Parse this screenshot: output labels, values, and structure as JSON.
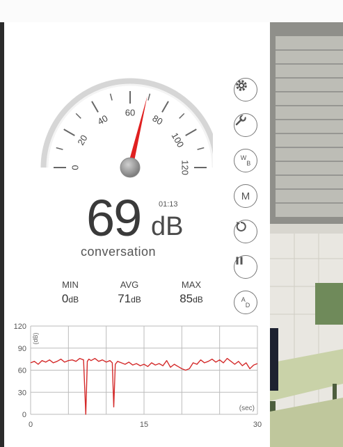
{
  "meter": {
    "value": "69",
    "unit": "dB",
    "timer": "01:13",
    "category": "conversation",
    "needle_value": 69,
    "scale_max": 120
  },
  "gauge": {
    "ticks": [
      "0",
      "20",
      "40",
      "60",
      "80",
      "100",
      "120"
    ]
  },
  "stats": {
    "min": {
      "label": "MIN",
      "value": "0",
      "unit": "dB"
    },
    "avg": {
      "label": "AVG",
      "value": "71",
      "unit": "dB"
    },
    "max": {
      "label": "MAX",
      "value": "85",
      "unit": "dB"
    }
  },
  "buttons": [
    {
      "name": "settings-button",
      "icon": "gear-icon"
    },
    {
      "name": "calibrate-button",
      "icon": "wrench-icon"
    },
    {
      "name": "weighting-button",
      "text": "W",
      "sub": "B"
    },
    {
      "name": "memory-button",
      "text": "M"
    },
    {
      "name": "reset-button",
      "icon": "reset-icon"
    },
    {
      "name": "pause-button",
      "icon": "pause-icon"
    },
    {
      "name": "ad-button",
      "text": "A",
      "sub": "D"
    }
  ],
  "colors": {
    "needle": "#e02020",
    "graph_line": "#d42a2a",
    "grid": "#bbbbbb",
    "button_border": "#777777"
  },
  "chart_data": {
    "type": "line",
    "title": "",
    "xlabel": "(sec)",
    "ylabel": "(dB)",
    "xlim": [
      0,
      30
    ],
    "ylim": [
      0,
      120
    ],
    "x_ticks": [
      "0",
      "15",
      "30"
    ],
    "y_ticks": [
      "120",
      "90",
      "60",
      "30",
      "0"
    ],
    "grid": true,
    "series": [
      {
        "x": [
          0,
          0.5,
          1,
          1.5,
          2,
          2.5,
          3,
          3.5,
          4,
          4.5,
          5,
          5.5,
          6,
          6.5,
          7,
          7.3,
          7.5,
          7.7,
          8,
          8.5,
          9,
          9.5,
          10,
          10.5,
          10.8,
          11,
          11.2,
          11.5,
          12,
          12.5,
          13,
          13.5,
          14,
          14.5,
          15,
          15.5,
          16,
          16.5,
          17,
          17.5,
          18,
          18.5,
          19,
          19.5,
          20,
          20.5,
          21,
          21.5,
          22,
          22.5,
          23,
          23.5,
          24,
          24.5,
          25,
          25.5,
          26,
          26.5,
          27,
          27.5,
          28,
          28.5,
          29,
          29.5,
          30
        ],
        "y": [
          70,
          72,
          68,
          73,
          71,
          74,
          70,
          72,
          75,
          71,
          73,
          74,
          72,
          76,
          74,
          0,
          72,
          75,
          73,
          76,
          72,
          74,
          71,
          73,
          70,
          10,
          68,
          72,
          70,
          68,
          71,
          67,
          69,
          66,
          68,
          65,
          70,
          67,
          69,
          66,
          73,
          64,
          68,
          65,
          62,
          60,
          62,
          70,
          68,
          74,
          70,
          72,
          75,
          71,
          74,
          70,
          76,
          72,
          68,
          72,
          66,
          70,
          62,
          67,
          69
        ]
      }
    ]
  }
}
